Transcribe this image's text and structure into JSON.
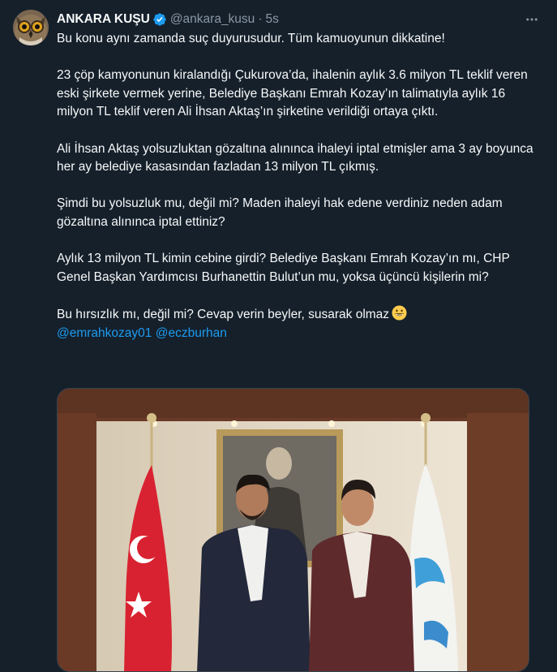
{
  "author": {
    "display_name": "ANKARA KUŞU",
    "handle": "@ankara_kusu",
    "separator": "·",
    "time": "5s",
    "verified": true
  },
  "icons": {
    "verified": "verified-badge-icon",
    "more": "more-options-icon",
    "emoji": "grinning-face-emoji"
  },
  "colors": {
    "background": "#15202b",
    "text": "#f7f9f9",
    "muted": "#8b98a5",
    "link": "#1d9bf0",
    "verified": "#1d9bf0"
  },
  "tweet": {
    "paragraphs": [
      "Bu konu aynı zamanda suç duyurusudur. Tüm kamuoyunun dikkatine!",
      "23 çöp kamyonunun kiralandığı Çukurova’da, ihalenin aylık 3.6 milyon TL teklif veren eski şirkete vermek yerine, Belediye Başkanı Emrah Kozay’ın talimatıyla aylık 16 milyon TL teklif veren Ali İhsan Aktaş’ın şirketine verildiği ortaya çıktı.",
      "Ali İhsan Aktaş yolsuzluktan gözaltına alınınca ihaleyi iptal etmişler ama 3 ay boyunca her ay belediye kasasından fazladan 13 milyon TL çıkmış.",
      "Şimdi bu yolsuzluk mu, değil mi? Maden ihaleyi hak edene verdiniz neden adam gözaltına alınınca iptal ettiniz?",
      "Aylık 13 milyon TL kimin cebine girdi? Belediye Başkanı Emrah Kozay’ın mı, CHP Genel Başkan Yardımcısı Burhanettin Bulut’un mu, yoksa üçüncü kişilerin mi?",
      "Bu hırsızlık mı, değil mi? Cevap verin beyler, susarak olmaz"
    ],
    "mentions": [
      "@emrahkozay01",
      "@eczburhan"
    ]
  },
  "media": {
    "type": "photo",
    "description_icon": "photo-two-men-with-flags"
  }
}
